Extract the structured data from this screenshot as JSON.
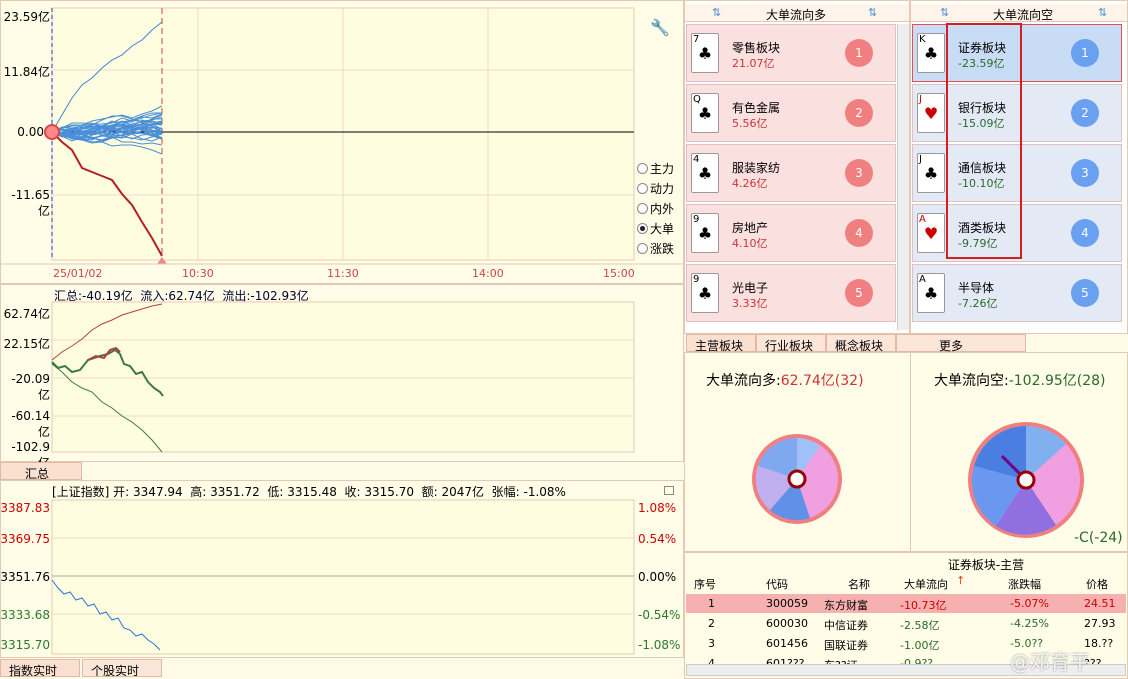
{
  "chart_main": {
    "y_ticks": [
      "23.59亿",
      "11.84亿",
      "0.00",
      "-11.65亿"
    ],
    "x_ticks": [
      "25/01/02",
      "10:30",
      "11:30",
      "14:00",
      "15:00"
    ]
  },
  "radios": [
    {
      "label": "主力",
      "on": false
    },
    {
      "label": "动力",
      "on": false
    },
    {
      "label": "内外",
      "on": false
    },
    {
      "label": "大单",
      "on": true
    },
    {
      "label": "涨跌",
      "on": false
    }
  ],
  "flow": {
    "summary": "汇总:-40.19亿  流入:62.74亿  流出:-102.93亿",
    "y_ticks": [
      "62.74亿",
      "22.15亿",
      "-20.09亿",
      "-60.14亿",
      "-102.9亿"
    ],
    "tab": "汇总"
  },
  "index": {
    "header": "[上证指数] 开: 3347.94  高: 3351.72  低: 3315.48  收: 3315.70  额: 2047亿  张幅: -1.08%",
    "y_left": [
      "3387.83",
      "3369.75",
      "3351.76",
      "3333.68",
      "3315.70"
    ],
    "y_right": [
      "1.08%",
      "0.54%",
      "0.00%",
      "-0.54%",
      "-1.08%"
    ],
    "tabs": [
      "指数实时",
      "个股实时"
    ]
  },
  "long": {
    "title": "大单流向多",
    "items": [
      {
        "card": "7",
        "name": "零售板块",
        "val": "21.07亿",
        "rank": "1"
      },
      {
        "card": "Q",
        "name": "有色金属",
        "val": "5.56亿",
        "rank": "2"
      },
      {
        "card": "4",
        "name": "服装家纺",
        "val": "4.26亿",
        "rank": "3"
      },
      {
        "card": "9",
        "name": "房地产",
        "val": "4.10亿",
        "rank": "4"
      },
      {
        "card": "9",
        "name": "光电子",
        "val": "3.33亿",
        "rank": "5"
      }
    ]
  },
  "short": {
    "title": "大单流向空",
    "items": [
      {
        "card": "K",
        "name": "证券板块",
        "val": "-23.59亿",
        "rank": "1"
      },
      {
        "card": "JOKER",
        "name": "银行板块",
        "val": "-15.09亿",
        "rank": "2"
      },
      {
        "card": "J",
        "name": "通信板块",
        "val": "-10.10亿",
        "rank": "3"
      },
      {
        "card": "A",
        "name": "酒类板块",
        "val": "-9.79亿",
        "rank": "4"
      },
      {
        "card": "A",
        "name": "半导体",
        "val": "-7.26亿",
        "rank": "5"
      }
    ]
  },
  "sector_tabs": [
    "主营板块",
    "行业板块",
    "概念板块",
    "更多"
  ],
  "pie": {
    "long_title": "大单流向多:",
    "long_val": "62.74亿(32)",
    "short_title": "大单流向空:",
    "short_val": "-102.95亿(28)",
    "short_note": "-C(-24)"
  },
  "table": {
    "title": "证券板块-主营",
    "headers": [
      "序号",
      "代码",
      "名称",
      "大单流向",
      "涨跌幅",
      "价格"
    ],
    "rows": [
      [
        "1",
        "300059",
        "东方财富",
        "-10.73亿",
        "-5.07%",
        "24.51"
      ],
      [
        "2",
        "600030",
        "中信证券",
        "-2.58亿",
        "-4.25%",
        "27.93"
      ],
      [
        "3",
        "601456",
        "国联证券",
        "-1.00亿",
        "-5.0??",
        "18.??"
      ],
      [
        "4",
        "601???",
        "东??证",
        "-0.9??",
        "",
        "???"
      ]
    ]
  },
  "watermark": "@邓育平",
  "colors": {
    "up": "#c0392b",
    "down": "#2e7d32",
    "accent": "#d33"
  }
}
